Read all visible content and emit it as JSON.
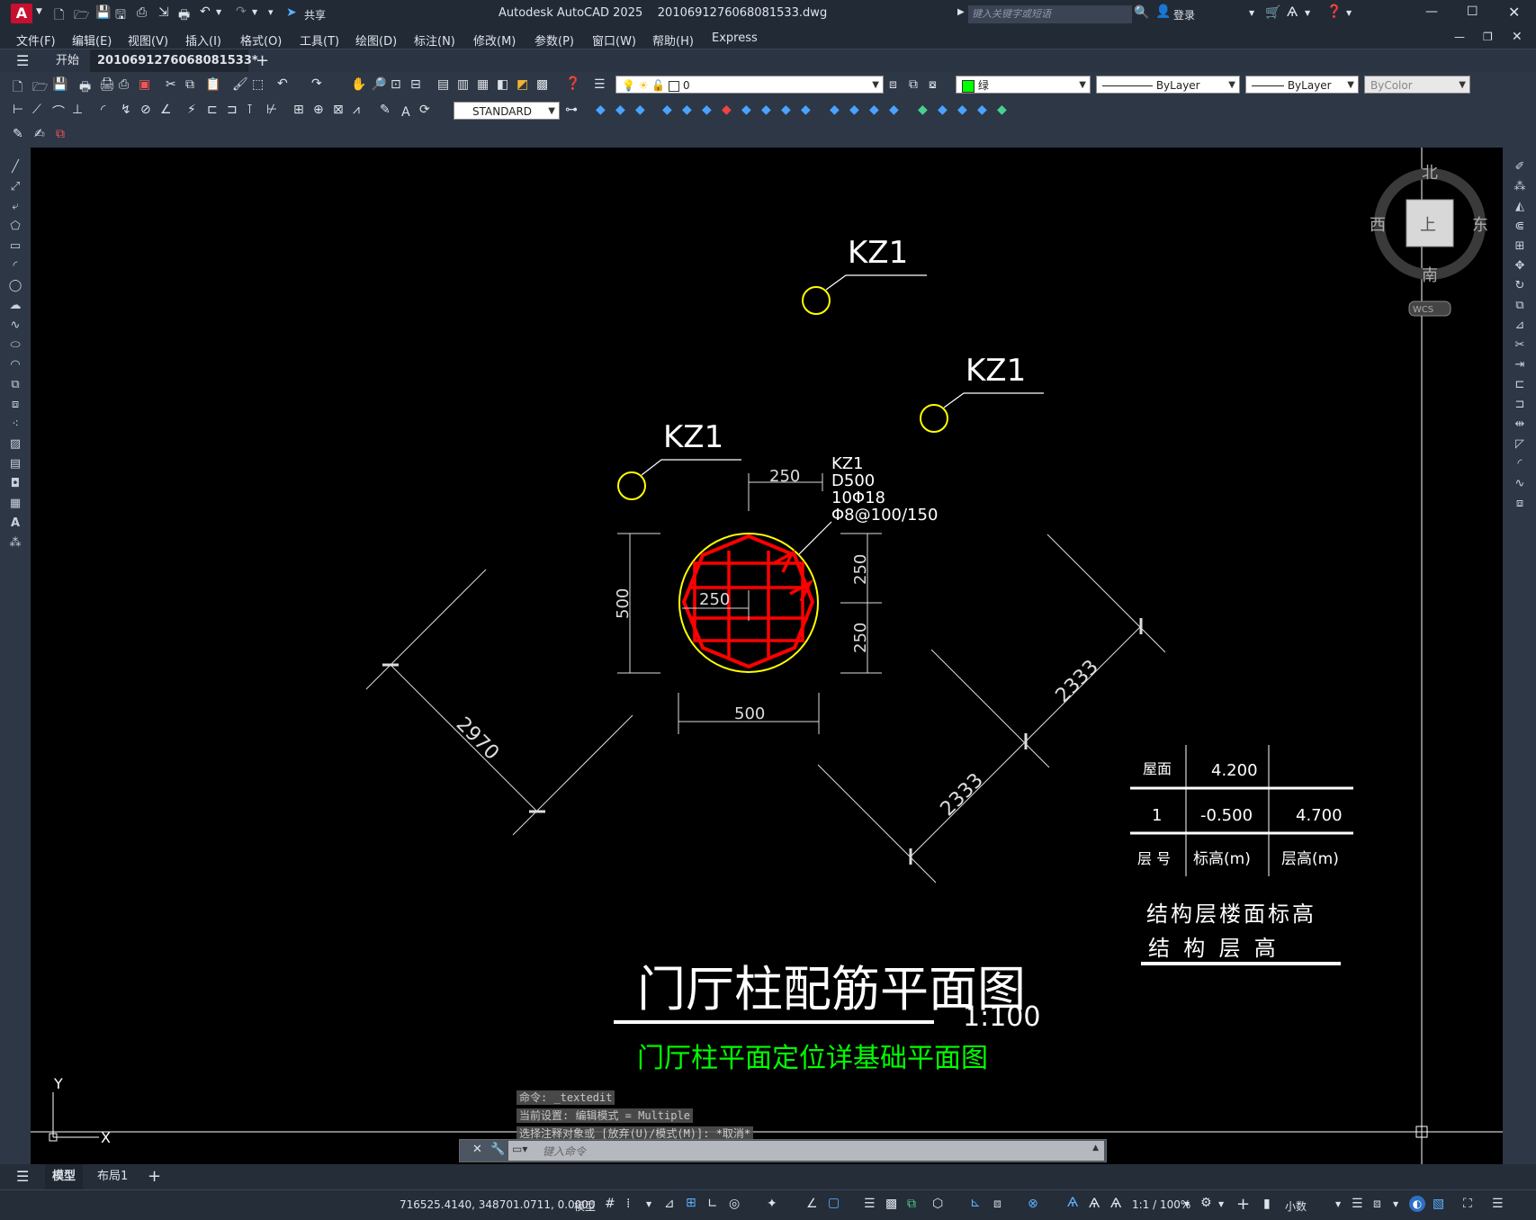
{
  "titlebar": {
    "app_logo": "A",
    "share_label": "共享",
    "title": "Autodesk AutoCAD 2025    2010691276068081533.dwg",
    "search_placeholder": "键入关键字或短语",
    "login_label": "登录"
  },
  "menu": [
    "文件(F)",
    "编辑(E)",
    "视图(V)",
    "插入(I)",
    "格式(O)",
    "工具(T)",
    "绘图(D)",
    "标注(N)",
    "修改(M)",
    "参数(P)",
    "窗口(W)",
    "帮助(H)",
    "Express"
  ],
  "tabs": {
    "start": "开始",
    "doc": "2010691276068081533*"
  },
  "layer": {
    "value": "0"
  },
  "color": {
    "value": "绿",
    "swatch": "#00ff00"
  },
  "linetype": {
    "value": "ByLayer"
  },
  "lineweight": {
    "value": "ByLayer"
  },
  "plotstyle": {
    "value": "ByColor"
  },
  "textstyle": {
    "value": "STANDARD"
  },
  "viewcube": {
    "north": "北",
    "south": "南",
    "east": "东",
    "west": "西",
    "top": "上",
    "wcs": "WCS"
  },
  "drawing": {
    "kz_label": "KZ1",
    "section_lines": [
      "KZ1",
      "D500",
      "10Φ18",
      "Φ8@100/150"
    ],
    "dims": {
      "d250_top": "250",
      "d250_inner": "250",
      "d500_left": "500",
      "d250_right_a": "250",
      "d250_right_b": "250",
      "d500_bottom": "500",
      "d2970": "2970",
      "d2333_a": "2333",
      "d2333_b": "2333"
    },
    "table": {
      "r1": [
        "屋面",
        "4.200",
        ""
      ],
      "r2": [
        "1",
        "-0.500",
        "4.700"
      ],
      "r3": [
        "层 号",
        "标高(m)",
        "层高(m)"
      ],
      "caption1": "结构层楼面标高",
      "caption2": "结  构  层  高"
    },
    "title": "门厅柱配筋平面图",
    "scale": "1:100",
    "subtitle": "门厅柱平面定位详基础平面图",
    "ucs_y": "Y",
    "ucs_x": "X",
    "colors": {
      "red": "#ff0000",
      "yellow": "#ffff00",
      "green": "#00ff00",
      "white": "#ffffff"
    }
  },
  "command": {
    "history": [
      "命令: _textedit",
      "当前设置: 编辑模式 = Multiple",
      "选择注释对象或 [放弃(U)/模式(M)]: *取消*"
    ],
    "placeholder": "键入命令"
  },
  "layouts": {
    "model": "模型",
    "layout1": "布局1"
  },
  "status": {
    "coords": "716525.4140, 348701.0711, 0.0000",
    "mode": "模型",
    "scale": "1:1 / 100%",
    "units": "小数"
  }
}
